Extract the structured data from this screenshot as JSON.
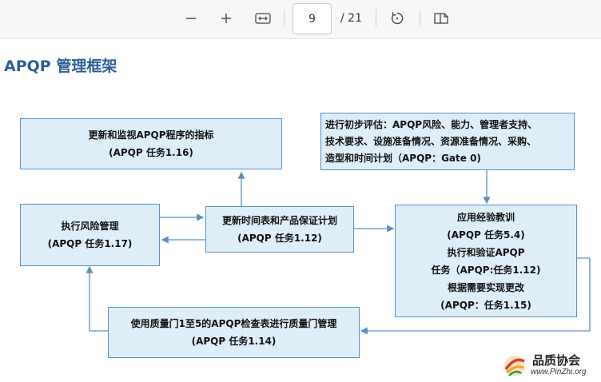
{
  "toolbar": {
    "zoom_out_icon": "minus-icon",
    "zoom_in_icon": "plus-icon",
    "fit_icon": "fit-width-icon",
    "page_current": "9",
    "page_total": "/ 21",
    "rotate_icon": "rotate-icon",
    "view_icon": "page-view-icon"
  },
  "document": {
    "title": "APQP 管理框架",
    "boxes": {
      "monitor": {
        "line1": "更新和监视APQP程序的指标",
        "line2": "(APQP 任务1.16)"
      },
      "initial_eval": {
        "line1": "进行初步评估：APQP风险、能力、管理者支持、",
        "line2": "技术要求、设施准备情况、资源准备情况、采购、",
        "line3": "造型和时间计划（APQP：Gate 0)"
      },
      "risk": {
        "line1": "执行风险管理",
        "line2": "(APQP 任务1.17)"
      },
      "timeline": {
        "line1": "更新时间表和产品保证计划",
        "line2": "(APQP 任务1.12)"
      },
      "lessons": {
        "line1": "应用经验教训",
        "line2": "(APQP 任务5.4)",
        "line3": "执行和验证APQP",
        "line4": "任务（APQP:任务1.12)",
        "line5": "根据需要实现更改",
        "line6": "(APQP：任务1.15)"
      },
      "gates": {
        "line1": "使用质量门1至5的APQP检查表进行质量门管理",
        "line2": "(APQP 任务1.14)"
      }
    }
  },
  "watermark": {
    "name": "品质协会",
    "url": "www.PinZhi.org"
  },
  "colors": {
    "box_fill": "#deeef9",
    "box_border": "#5a8fc4",
    "title": "#2f5d9a",
    "arrow": "#5a8fc4"
  }
}
